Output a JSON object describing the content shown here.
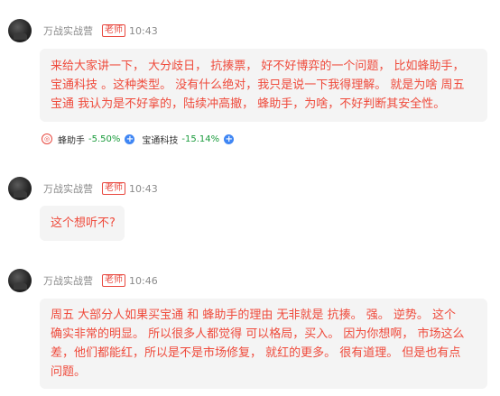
{
  "messages": [
    {
      "sender": "万战实战营",
      "role": "老师",
      "time": "10:43",
      "lines": [
        "来给大家讲一下， 大分歧日， 抗揍票， 好不好博弈的一个问题， 比如蜂助手，",
        "宝通科技 。这种类型。 没有什么绝对，我只是说一下我得理解。 就是为啥 周五",
        "宝通 我认为是不好拿的，陆续冲高撤， 蜂助手，为啥，不好判断其安全性。"
      ],
      "stocks": [
        {
          "name": "蜂助手",
          "change": "-5.50%"
        },
        {
          "name": "宝通科技",
          "change": "-15.14%"
        }
      ]
    },
    {
      "sender": "万战实战营",
      "role": "老师",
      "time": "10:43",
      "lines": [
        "这个想听不?"
      ]
    },
    {
      "sender": "万战实战营",
      "role": "老师",
      "time": "10:46",
      "lines": [
        "周五 大部分人如果买宝通 和 蜂助手的理由 无非就是 抗揍。 强。 逆势。 这个",
        "确实非常的明显。 所以很多人都觉得 可以格局，买入。 因为你想啊， 市场这么",
        "差，他们都能红，所以是不是市场修复， 就红的更多。 很有道理。 但是也有点",
        "问题。"
      ]
    }
  ],
  "colors": {
    "message_text": "#ef4a3b",
    "role_badge": "#e8483f",
    "stock_down": "#1a9b3c",
    "add_button": "#3f86f4"
  },
  "icons": {
    "avatar": "avatar",
    "stock_logo": "stock-logo-icon",
    "add": "plus-circle-icon"
  }
}
